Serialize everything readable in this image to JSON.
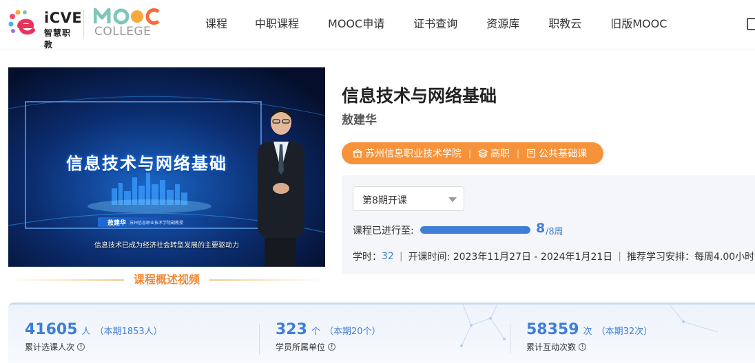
{
  "header": {
    "logo_icve": {
      "word": "iCVE",
      "sub": "智慧职教"
    },
    "logo_mooc": {
      "word": "MOOC",
      "college": "COLLEGE"
    },
    "nav": [
      "课程",
      "中职课程",
      "MOOC申请",
      "证书查询",
      "资源库",
      "职教云",
      "旧版MOOC"
    ]
  },
  "video": {
    "screen_title": "信息技术与网络基础",
    "presenter_name": "敖建华",
    "presenter_org": "苏州信息职业技术学院副教授",
    "subtitle": "信息技术已成为经济社会转型发展的主要驱动力"
  },
  "video_caption": "课程概述视频",
  "course": {
    "title": "信息技术与网络基础",
    "teacher": "敖建华",
    "tags": [
      {
        "icon": "school-icon",
        "label": "苏州信息职业技术学院"
      },
      {
        "icon": "layers-icon",
        "label": "高职"
      },
      {
        "icon": "book-icon",
        "label": "公共基础课"
      }
    ],
    "tag_separator": "|"
  },
  "term": {
    "selected": "第8期开课"
  },
  "progress": {
    "label": "课程已进行至:",
    "current": "8",
    "total_text": "/8周",
    "fraction": 1.0
  },
  "meta": {
    "hours_label": "学时：",
    "hours_value": "32",
    "period_label": "开课时间: 2023年11月27日 - 2024年1月21日",
    "schedule_label": "推荐学习安排：每周4.00小时"
  },
  "stats": [
    {
      "number": "41605",
      "unit": "人",
      "period": "（本期1853人）",
      "label": "累计选课人次"
    },
    {
      "number": "323",
      "unit": "个",
      "period": "（本期20个）",
      "label": "学员所属单位"
    },
    {
      "number": "58359",
      "unit": "次",
      "period": "（本期32次）",
      "label": "累计互动次数"
    }
  ],
  "colors": {
    "accent_blue": "#3f7ed8",
    "accent_orange": "#f6933a",
    "caption_orange": "#f08a3a"
  }
}
